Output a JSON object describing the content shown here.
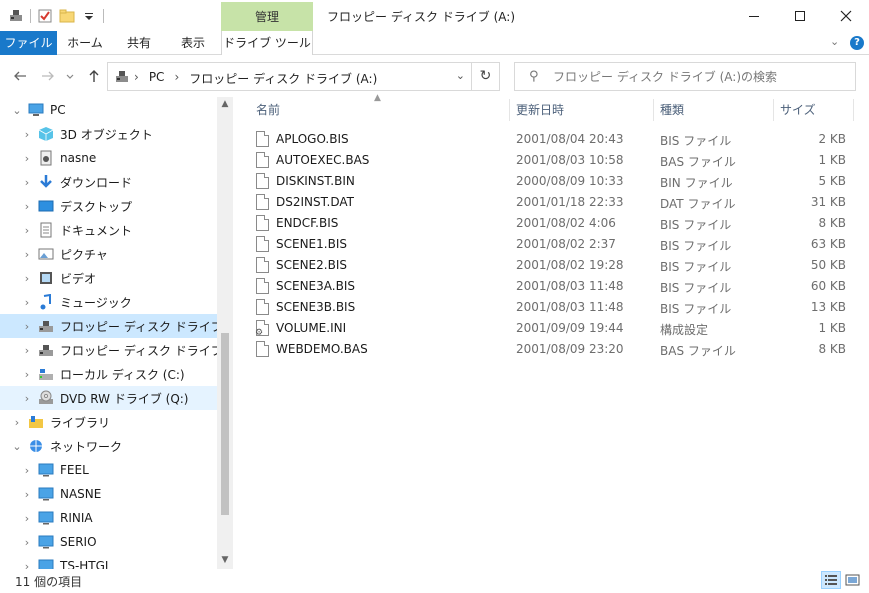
{
  "window": {
    "title": "フロッピー ディスク ドライブ (A:)",
    "tool_tab_header": "管理"
  },
  "ribbon": {
    "tabs": [
      "ファイル",
      "ホーム",
      "共有",
      "表示",
      "ドライブ ツール"
    ],
    "help": "?"
  },
  "address": {
    "crumbs": [
      "PC",
      "フロッピー ディスク ドライブ (A:)"
    ]
  },
  "search": {
    "placeholder": "フロッピー ディスク ドライブ (A:)の検索"
  },
  "navigation": {
    "items": [
      {
        "label": "PC",
        "level": 0,
        "expanded": true,
        "icon": "pc-icon"
      },
      {
        "label": "3D オブジェクト",
        "level": 1,
        "icon": "3d-objects-icon"
      },
      {
        "label": "nasne",
        "level": 1,
        "icon": "media-device-icon"
      },
      {
        "label": "ダウンロード",
        "level": 1,
        "icon": "download-icon"
      },
      {
        "label": "デスクトップ",
        "level": 1,
        "icon": "desktop-icon"
      },
      {
        "label": "ドキュメント",
        "level": 1,
        "icon": "documents-icon"
      },
      {
        "label": "ピクチャ",
        "level": 1,
        "icon": "pictures-icon"
      },
      {
        "label": "ビデオ",
        "level": 1,
        "icon": "videos-icon"
      },
      {
        "label": "ミュージック",
        "level": 1,
        "icon": "music-icon"
      },
      {
        "label": "フロッピー ディスク ドライブ (A:)",
        "level": 1,
        "icon": "floppy-drive-icon",
        "state": "selected"
      },
      {
        "label": "フロッピー ディスク ドライブ (B:)",
        "level": 1,
        "icon": "floppy-drive-icon"
      },
      {
        "label": "ローカル ディスク (C:)",
        "level": 1,
        "icon": "local-disk-icon"
      },
      {
        "label": "DVD RW ドライブ (Q:)",
        "level": 1,
        "icon": "dvd-drive-icon",
        "state": "hover"
      },
      {
        "label": "ライブラリ",
        "level": 0,
        "icon": "library-icon"
      },
      {
        "label": "ネットワーク",
        "level": 0,
        "expanded": true,
        "icon": "network-icon"
      },
      {
        "label": "FEEL",
        "level": 1,
        "icon": "computer-icon"
      },
      {
        "label": "NASNE",
        "level": 1,
        "icon": "computer-icon"
      },
      {
        "label": "RINIA",
        "level": 1,
        "icon": "computer-icon"
      },
      {
        "label": "SERIO",
        "level": 1,
        "icon": "computer-icon"
      },
      {
        "label": "TS-HTGL",
        "level": 1,
        "icon": "computer-icon"
      }
    ]
  },
  "columns": {
    "name": "名前",
    "date": "更新日時",
    "type": "種類",
    "size": "サイズ"
  },
  "files": [
    {
      "name": "APLOGO.BIS",
      "date": "2001/08/04 20:43",
      "type": "BIS ファイル",
      "size": "2 KB",
      "icon": "file-icon"
    },
    {
      "name": "AUTOEXEC.BAS",
      "date": "2001/08/03 10:58",
      "type": "BAS ファイル",
      "size": "1 KB",
      "icon": "file-icon"
    },
    {
      "name": "DISKINST.BIN",
      "date": "2000/08/09 10:33",
      "type": "BIN ファイル",
      "size": "5 KB",
      "icon": "file-icon"
    },
    {
      "name": "DS2INST.DAT",
      "date": "2001/01/18 22:33",
      "type": "DAT ファイル",
      "size": "31 KB",
      "icon": "file-icon"
    },
    {
      "name": "ENDCF.BIS",
      "date": "2001/08/02 4:06",
      "type": "BIS ファイル",
      "size": "8 KB",
      "icon": "file-icon"
    },
    {
      "name": "SCENE1.BIS",
      "date": "2001/08/02 2:37",
      "type": "BIS ファイル",
      "size": "63 KB",
      "icon": "file-icon"
    },
    {
      "name": "SCENE2.BIS",
      "date": "2001/08/02 19:28",
      "type": "BIS ファイル",
      "size": "50 KB",
      "icon": "file-icon"
    },
    {
      "name": "SCENE3A.BIS",
      "date": "2001/08/03 11:48",
      "type": "BIS ファイル",
      "size": "60 KB",
      "icon": "file-icon"
    },
    {
      "name": "SCENE3B.BIS",
      "date": "2001/08/03 11:48",
      "type": "BIS ファイル",
      "size": "13 KB",
      "icon": "file-icon"
    },
    {
      "name": "VOLUME.INI",
      "date": "2001/09/09 19:44",
      "type": "構成設定",
      "size": "1 KB",
      "icon": "settings-file-icon"
    },
    {
      "name": "WEBDEMO.BAS",
      "date": "2001/08/09 23:20",
      "type": "BAS ファイル",
      "size": "8 KB",
      "icon": "file-icon"
    }
  ],
  "status": {
    "item_count": "11 個の項目"
  },
  "colors": {
    "accent": "#1979ca",
    "tool_tab": "#c7e3a8",
    "selected": "#cce8ff",
    "hover": "#e5f3ff"
  }
}
